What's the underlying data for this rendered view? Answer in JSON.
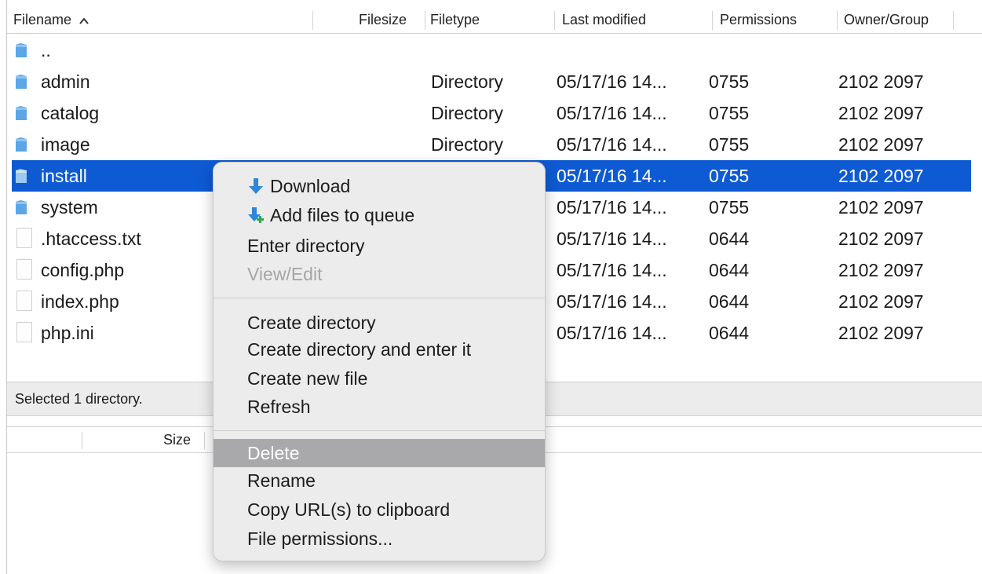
{
  "header": {
    "filename": "Filename",
    "filesize": "Filesize",
    "filetype": "Filetype",
    "last_modified": "Last modified",
    "permissions": "Permissions",
    "owner_group": "Owner/Group"
  },
  "files": [
    {
      "name": "..",
      "type": "",
      "modified": "",
      "perms": "",
      "owner": "",
      "kind": "folder"
    },
    {
      "name": "admin",
      "type": "Directory",
      "modified": "05/17/16 14...",
      "perms": "0755",
      "owner": "2102 2097",
      "kind": "folder"
    },
    {
      "name": "catalog",
      "type": "Directory",
      "modified": "05/17/16 14...",
      "perms": "0755",
      "owner": "2102 2097",
      "kind": "folder"
    },
    {
      "name": "image",
      "type": "Directory",
      "modified": "05/17/16 14...",
      "perms": "0755",
      "owner": "2102 2097",
      "kind": "folder"
    },
    {
      "name": "install",
      "type": "",
      "modified": "05/17/16 14...",
      "perms": "0755",
      "owner": "2102 2097",
      "kind": "folder",
      "selected": true
    },
    {
      "name": "system",
      "type": "",
      "modified": "05/17/16 14...",
      "perms": "0755",
      "owner": "2102 2097",
      "kind": "folder"
    },
    {
      "name": ".htaccess.txt",
      "type": "",
      "modified": "05/17/16 14...",
      "perms": "0644",
      "owner": "2102 2097",
      "kind": "file"
    },
    {
      "name": "config.php",
      "type": "",
      "modified": "05/17/16 14...",
      "perms": "0644",
      "owner": "2102 2097",
      "kind": "file"
    },
    {
      "name": "index.php",
      "type": "",
      "modified": "05/17/16 14...",
      "perms": "0644",
      "owner": "2102 2097",
      "kind": "file"
    },
    {
      "name": "php.ini",
      "type": "",
      "modified": "05/17/16 14...",
      "perms": "0644",
      "owner": "2102 2097",
      "kind": "file"
    }
  ],
  "status": "Selected 1 directory.",
  "lower_header": {
    "size": "Size"
  },
  "context_menu": {
    "download": "Download",
    "add_to_queue": "Add files to queue",
    "enter_directory": "Enter directory",
    "view_edit": "View/Edit",
    "create_directory": "Create directory",
    "create_directory_enter": "Create directory and enter it",
    "create_new_file": "Create new file",
    "refresh": "Refresh",
    "delete": "Delete",
    "rename": "Rename",
    "copy_url": "Copy URL(s) to clipboard",
    "file_permissions": "File permissions..."
  },
  "colors": {
    "selection": "#0d5ad3",
    "menu_highlight": "#a9a9ab",
    "folder": "#5aa6e6"
  },
  "icons": {
    "sort": "chevron-up-icon",
    "folder": "folder-icon",
    "file": "file-icon",
    "download": "download-arrow-icon",
    "queue": "add-to-queue-icon"
  }
}
